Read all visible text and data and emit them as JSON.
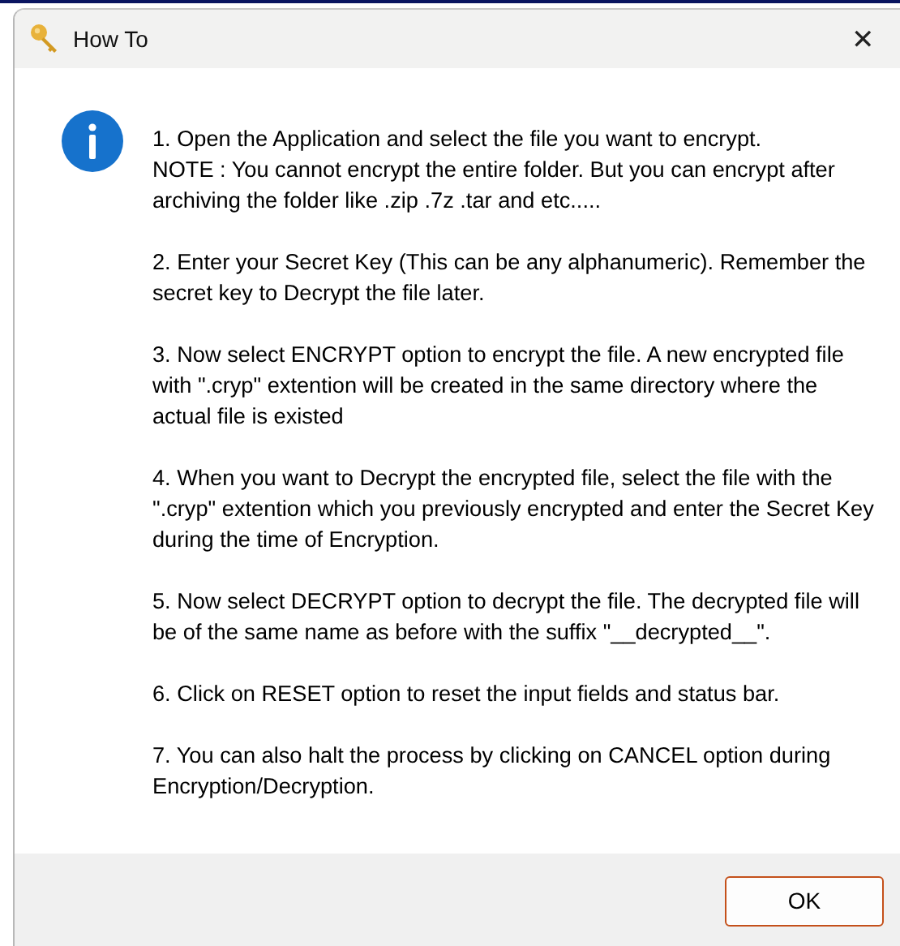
{
  "window": {
    "title": "How To",
    "close": "✕"
  },
  "paragraphs": [
    "1. Open the Application and select the file you want to encrypt.\nNOTE : You cannot encrypt the entire folder. But you can encrypt after archiving the folder like .zip .7z .tar and etc.....",
    "2. Enter your Secret Key (This can be any alphanumeric). Remember the secret key to  Decrypt the file later.",
    "3. Now select ENCRYPT option to encrypt the file. A new encrypted file with \".cryp\" extention will be created in the same directory where the actual file is existed",
    "4. When you want to Decrypt the encrypted file, select the file with the \".cryp\" extention which you previously encrypted and enter the Secret Key during the time of Encryption.",
    "5. Now select DECRYPT option to decrypt the file. The decrypted file will be of the same name as before with the suffix \"__decrypted__\".",
    "6. Click on RESET option to reset the input fields and status bar.",
    "7. You can also halt the process by clicking on CANCEL option during Encryption/Decryption."
  ],
  "buttons": [
    {
      "label": "OK",
      "focused": true
    }
  ]
}
